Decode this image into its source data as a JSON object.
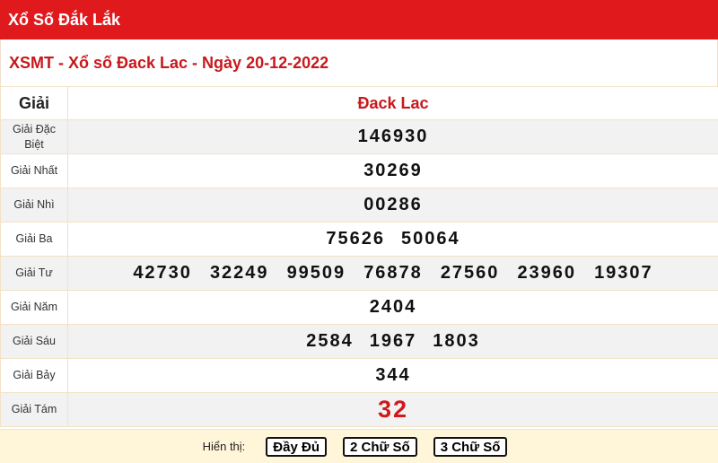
{
  "header": {
    "title": "Xổ Số Đắk Lắk"
  },
  "sub_header": {
    "title": "XSMT - Xổ số Đack Lac - Ngày 20-12-2022"
  },
  "table": {
    "col_prize": "Giải",
    "col_province": "Đack Lac",
    "prizes": [
      {
        "label": "Giải Đặc Biệt",
        "numbers": [
          "146930"
        ]
      },
      {
        "label": "Giải Nhất",
        "numbers": [
          "30269"
        ]
      },
      {
        "label": "Giải Nhì",
        "numbers": [
          "00286"
        ]
      },
      {
        "label": "Giải Ba",
        "numbers": [
          "75626",
          "50064"
        ]
      },
      {
        "label": "Giải Tư",
        "numbers": [
          "42730",
          "32249",
          "99509",
          "76878",
          "27560",
          "23960",
          "19307"
        ]
      },
      {
        "label": "Giải Năm",
        "numbers": [
          "2404"
        ]
      },
      {
        "label": "Giải Sáu",
        "numbers": [
          "2584",
          "1967",
          "1803"
        ]
      },
      {
        "label": "Giải Bảy",
        "numbers": [
          "344"
        ]
      },
      {
        "label": "Giải Tám",
        "numbers": [
          "32"
        ]
      }
    ]
  },
  "footer": {
    "display_label": "Hiển thị:",
    "btn_full": "Đầy Đủ",
    "btn_two": "2 Chữ Số",
    "btn_three": "3 Chữ Số"
  },
  "colors": {
    "brand_red": "#e0191d",
    "title_red": "#c8181c",
    "footer_bg": "#fff5d9"
  }
}
